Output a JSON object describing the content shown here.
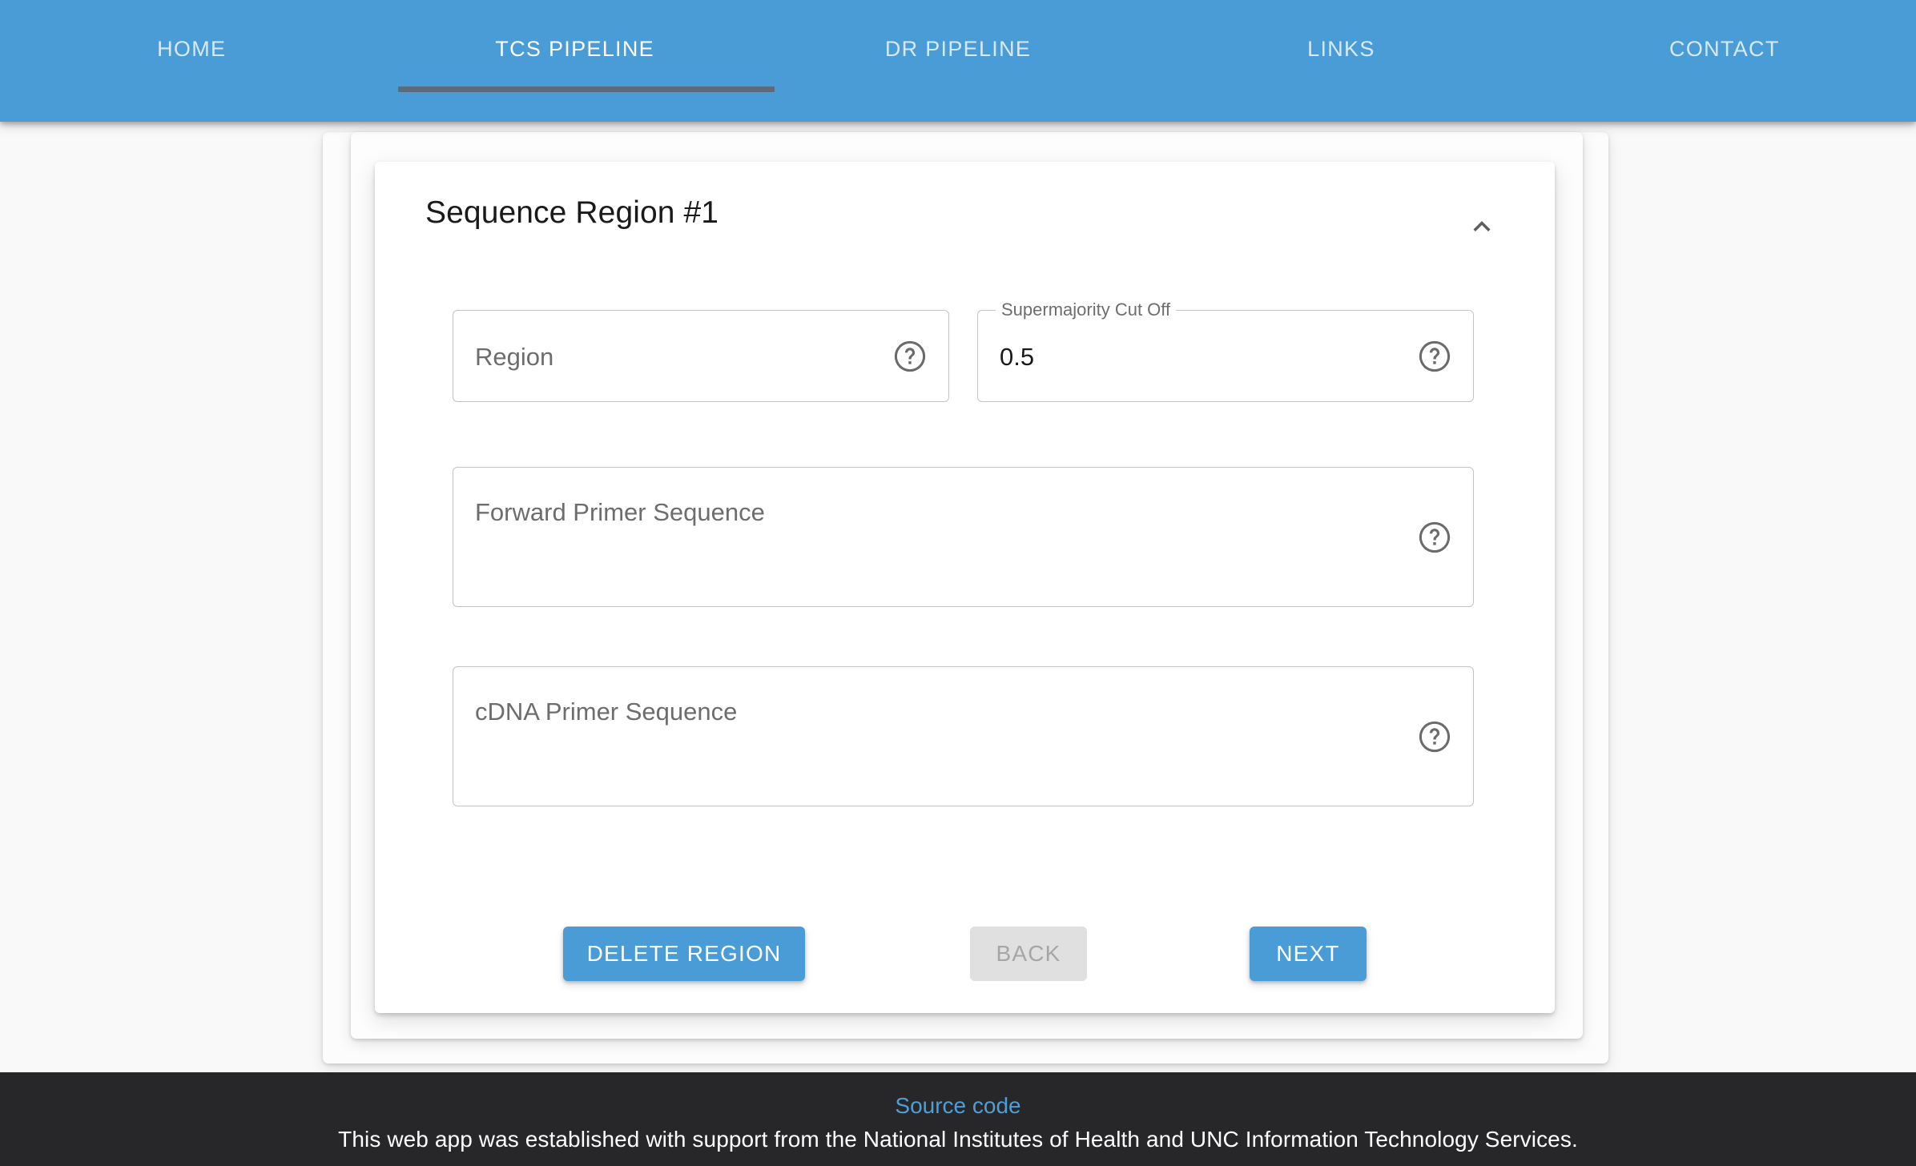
{
  "nav": {
    "background_color": "#4a9cd6",
    "active_index": 1,
    "indicator_color": "#5c6b7a",
    "tabs": [
      {
        "label": "HOME"
      },
      {
        "label": "TCS PIPELINE"
      },
      {
        "label": "DR PIPELINE"
      },
      {
        "label": "LINKS"
      },
      {
        "label": "CONTACT"
      }
    ]
  },
  "card": {
    "title": "Sequence Region #1",
    "collapse_icon": "chevron-up-icon",
    "fields": {
      "region": {
        "placeholder": "Region",
        "value": "",
        "help_icon": "help-circle-icon"
      },
      "supermajority_cutoff": {
        "legend": "Supermajority Cut Off",
        "value": "0.5",
        "help_icon": "help-circle-icon"
      },
      "forward_primer": {
        "placeholder": "Forward Primer Sequence",
        "value": "",
        "help_icon": "help-circle-icon"
      },
      "cdna_primer": {
        "placeholder": "cDNA Primer Sequence",
        "value": "",
        "help_icon": "help-circle-icon"
      }
    },
    "buttons": {
      "delete_region": {
        "label": "DELETE REGION",
        "state": "enabled",
        "color": "#4a9cd6"
      },
      "back": {
        "label": "BACK",
        "state": "disabled",
        "color": "#e0e0e0"
      },
      "next": {
        "label": "NEXT",
        "state": "enabled",
        "color": "#4a9cd6"
      }
    }
  },
  "footer": {
    "background_color": "#272729",
    "link_label": "Source code",
    "link_color": "#4d9fd8",
    "attribution": "This web app was established with support from the National Institutes of Health and UNC Information Technology Services."
  }
}
